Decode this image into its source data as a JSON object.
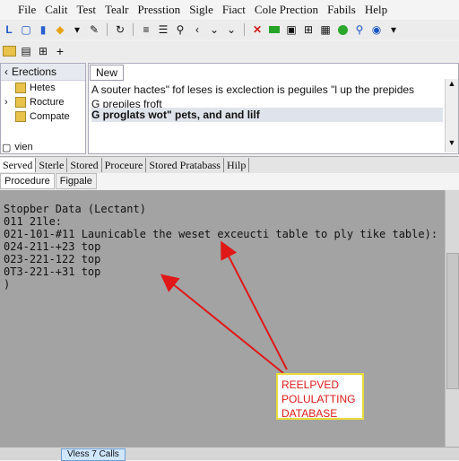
{
  "menu": [
    "File",
    "Calit",
    "Test",
    "Tealr",
    "Presstion",
    "Sigle",
    "Fiact",
    "Cole Prection",
    "Fabils",
    "Help"
  ],
  "toolbar1_icons": [
    "run-icon",
    "lock-icon",
    "folder-icon",
    "key-icon",
    "refresh-icon",
    "list-icon",
    "align-icon",
    "search-icon",
    "chevron-icon",
    "chevron-icon",
    "stop-icon",
    "green-square-icon",
    "save-icon",
    "grid-icon",
    "table-icon",
    "green-circle-icon",
    "search-icon",
    "globe-icon"
  ],
  "toolbar2_icons": [
    "folder-icon",
    "document-icon",
    "grid-icon",
    "plus-icon"
  ],
  "tree": {
    "header": "Erections",
    "items": [
      {
        "label": "Hetes"
      },
      {
        "label": "Rocture"
      },
      {
        "label": "Compate"
      }
    ],
    "footer": "vien"
  },
  "editor": {
    "tab": "New",
    "lines": [
      "A souter hactes\" fof leses is exclection is peguiles \"l up the prepides",
      "G prepiles froft",
      "G proglats wot\" pets, and and lilf"
    ]
  },
  "tabs": [
    "Served",
    "Sterle",
    "Stored",
    "Proceure",
    "Stored Pratabass",
    "Hilp"
  ],
  "subtabs": [
    "Procedure",
    "Figpale"
  ],
  "output": {
    "lines": [
      "Stopber Data (Lectant)",
      "011 21le:",
      "021-101-#11 Launicable the weset exceucti table to ply tike table):",
      "024-211-+23 top",
      "023-221-122 top",
      "0T3-221-+31 top",
      ")"
    ]
  },
  "annotation": {
    "lines": [
      "REELPVED",
      "POLULATTING",
      "DATABASE"
    ],
    "color": "#dd1a1a"
  },
  "status": {
    "button": "Vless 7 Calls"
  }
}
